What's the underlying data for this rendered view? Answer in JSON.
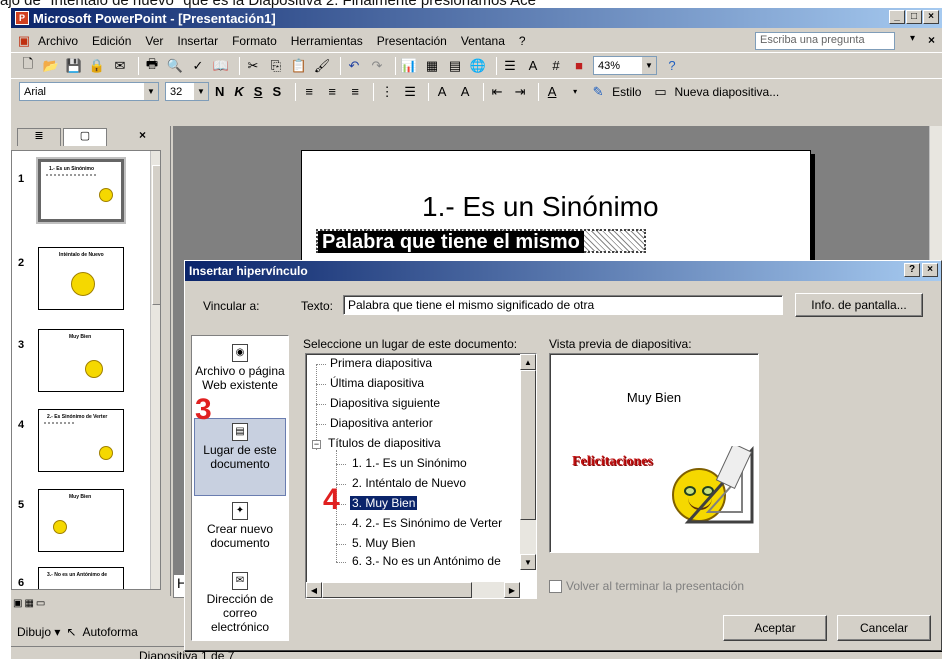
{
  "caption": "ajo de \"Inténtalo de nuevo\" que es la Diapositiva 2. Finalmente presionamos Ace",
  "window": {
    "title": "Microsoft PowerPoint - [Presentación1]",
    "controls": [
      "_",
      "□",
      "×"
    ]
  },
  "menu": {
    "items": [
      "Archivo",
      "Edición",
      "Ver",
      "Insertar",
      "Formato",
      "Herramientas",
      "Presentación",
      "Ventana",
      "?"
    ],
    "ask_placeholder": "Escriba una pregunta"
  },
  "toolbar": {
    "zoom": "43%"
  },
  "format_toolbar": {
    "font": "Arial",
    "size": "32",
    "bold": "N",
    "italic": "K",
    "underline": "S",
    "shadow": "S",
    "style_label": "Estilo",
    "new_slide_label": "Nueva diapositiva..."
  },
  "left_pane": {
    "tabs": [
      "≣",
      "▢"
    ],
    "close": "×",
    "slides": [
      {
        "num": "1",
        "title": "1.- Es un Sinónimo"
      },
      {
        "num": "2",
        "title": "Inténtalo de Nuevo"
      },
      {
        "num": "3",
        "title": "Muy Bien"
      },
      {
        "num": "4",
        "title": "2.- Es Sinónimo de Verter"
      },
      {
        "num": "5",
        "title": "Muy Bien"
      },
      {
        "num": "6",
        "title": "3.- No es un Antónimo de"
      }
    ]
  },
  "slide": {
    "title": "1.- Es un Sinónimo",
    "body": "Palabra que tiene el mismo"
  },
  "notes_text": "Ha",
  "drawbar": {
    "draw_label": "Dibujo ▾",
    "autoshapes_label": "Autoforma"
  },
  "status": {
    "slide": "Diapositiva 1 de 7"
  },
  "dialog": {
    "title": "Insertar hipervínculo",
    "help": "?",
    "close": "×",
    "link_to_label": "Vincular a:",
    "link_options": [
      {
        "label": "Archivo o página Web existente",
        "icon": "globe-file-icon"
      },
      {
        "label": "Lugar de este documento",
        "icon": "document-place-icon"
      },
      {
        "label": "Crear nuevo documento",
        "icon": "new-document-icon"
      },
      {
        "label": "Dirección de correo electrónico",
        "icon": "email-icon"
      }
    ],
    "text_label": "Texto:",
    "text_value": "Palabra que tiene el mismo significado de otra",
    "screentip_button": "Info. de pantalla...",
    "select_place_label": "Seleccione un lugar de este documento:",
    "tree": {
      "items": [
        "Primera diapositiva",
        "Última diapositiva",
        "Diapositiva siguiente",
        "Diapositiva anterior"
      ],
      "group": "Títulos de diapositiva",
      "children": [
        "1. 1.- Es un Sinónimo",
        "2. Inténtalo de Nuevo",
        "3. Muy Bien",
        "4. 2.- Es Sinónimo de Verter",
        "5. Muy Bien",
        "6. 3.- No es un Antónimo de"
      ],
      "selected_index": 2
    },
    "preview_label": "Vista previa de diapositiva:",
    "preview": {
      "title": "Muy Bien",
      "congrats": "Felicitaciones"
    },
    "return_checkbox": "Volver al terminar la presentación",
    "ok_button": "Aceptar",
    "cancel_button": "Cancelar"
  },
  "annotations": {
    "mark3": "3",
    "mark4": "4"
  },
  "colors": {
    "titlebar": "#0a246a",
    "selection": "#0a246a",
    "annotation": "#e02020",
    "face": "#d4d0c8"
  }
}
